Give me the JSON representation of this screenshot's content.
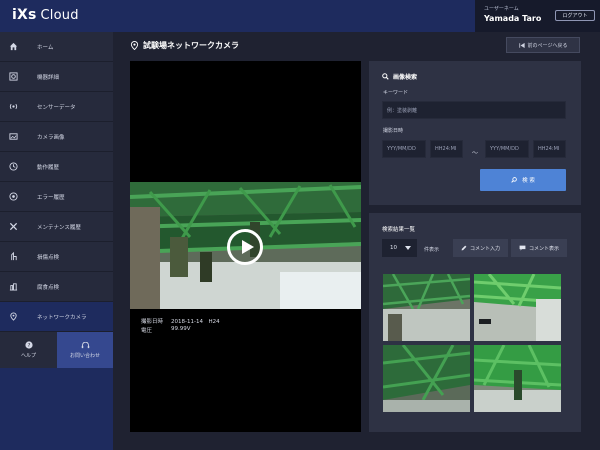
{
  "header": {
    "brand": "iXs",
    "brand_suffix": "Cloud",
    "user_label": "ユーザーネーム",
    "user_name": "Yamada Taro",
    "logout_label": "ログアウト"
  },
  "sidebar": {
    "items": [
      {
        "label": "ホーム",
        "icon": "home-icon"
      },
      {
        "label": "機器詳細",
        "icon": "device-detail-icon"
      },
      {
        "label": "センサーデータ",
        "icon": "sensor-icon"
      },
      {
        "label": "カメラ画像",
        "icon": "camera-image-icon"
      },
      {
        "label": "動作履歴",
        "icon": "clock-icon"
      },
      {
        "label": "エラー履歴",
        "icon": "error-icon"
      },
      {
        "label": "メンテナンス履歴",
        "icon": "wrench-icon"
      },
      {
        "label": "損傷点検",
        "icon": "inspection-icon"
      },
      {
        "label": "腐食点検",
        "icon": "corrosion-icon"
      },
      {
        "label": "ネットワークカメラ",
        "icon": "location-pin-icon",
        "active": true
      }
    ],
    "help_label": "ヘルプ",
    "contact_label": "お問い合わせ"
  },
  "page": {
    "title": "試験場ネットワークカメラ",
    "back_label": "前のページへ戻る"
  },
  "video": {
    "date_label": "撮影日時",
    "date_value": "2018-11-14　H24",
    "voltage_label": "電圧",
    "voltage_value": "99.99V"
  },
  "search": {
    "title": "画像検索",
    "keyword_label": "キーワード",
    "keyword_placeholder": "例：塗装剥離",
    "date_label": "撮影日時",
    "date_from_placeholder": "YYY/MM/DD",
    "time_from_placeholder": "HH24:MI",
    "range_separator": "～",
    "date_to_placeholder": "YYY/MM/DD",
    "time_to_placeholder": "HH24:MI",
    "button_label": "検 索"
  },
  "results": {
    "title": "検索結果一覧",
    "count_value": "10",
    "count_label": "件表示",
    "comment_input_label": "コメント入力",
    "comment_view_label": "コメント表示"
  },
  "colors": {
    "header": "#1e2b5e",
    "panel": "#2e3244",
    "accent": "#4e83d6",
    "steel_green": "#3fa64a"
  }
}
